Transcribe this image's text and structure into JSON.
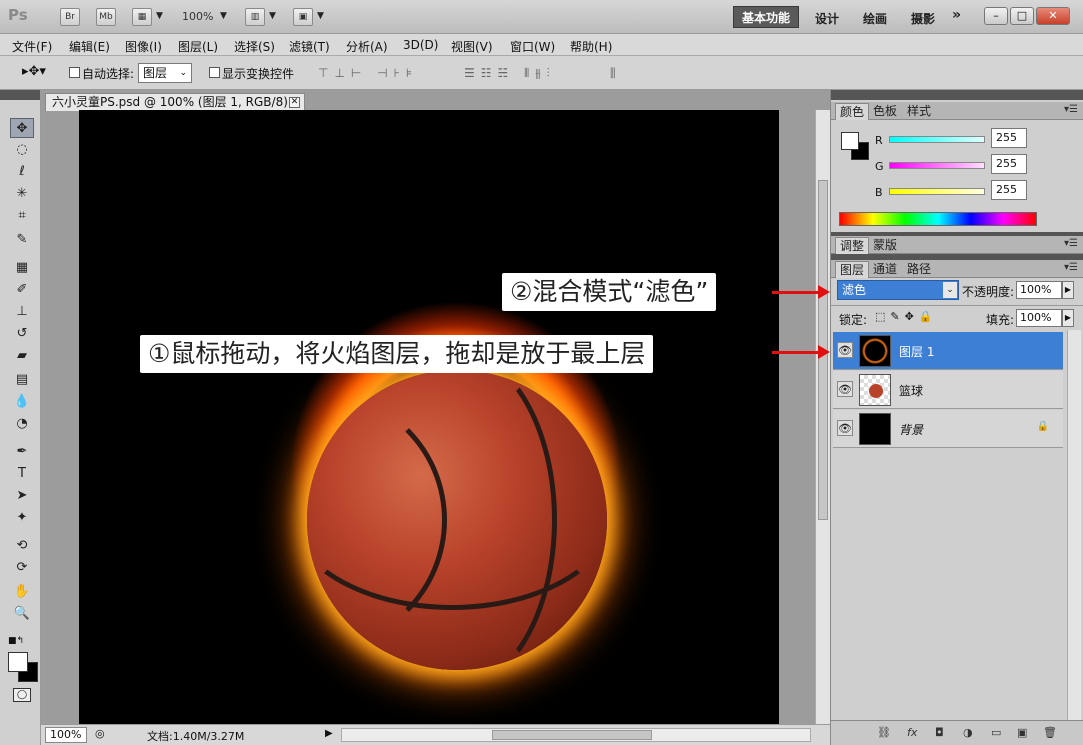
{
  "app": {
    "logo": "Ps",
    "bridge_btn": "Br",
    "minibridge_btn": "Mb",
    "zoom": "100%",
    "workspaces": [
      "基本功能",
      "设计",
      "绘画",
      "摄影"
    ],
    "more": "»"
  },
  "menubar": [
    "文件(F)",
    "编辑(E)",
    "图像(I)",
    "图层(L)",
    "选择(S)",
    "滤镜(T)",
    "分析(A)",
    "3D(D)",
    "视图(V)",
    "窗口(W)",
    "帮助(H)"
  ],
  "options": {
    "auto_select_label": "自动选择:",
    "auto_select_value": "图层",
    "show_transform_label": "显示变换控件"
  },
  "document": {
    "tab_title": "六小灵童PS.psd @ 100% (图层 1, RGB/8) *",
    "zoom": "100%",
    "doc_size": "文档:1.40M/3.27M"
  },
  "color_panel": {
    "tabs": [
      "颜色",
      "色板",
      "样式"
    ],
    "channels": [
      {
        "label": "R",
        "value": "255",
        "color": "#00e0e0"
      },
      {
        "label": "G",
        "value": "255",
        "color": "#e000e0"
      },
      {
        "label": "B",
        "value": "255",
        "color": "#e0e000"
      }
    ]
  },
  "adjust_panel": {
    "tabs": [
      "调整",
      "蒙版"
    ]
  },
  "layers_panel": {
    "tabs": [
      "图层",
      "通道",
      "路径"
    ],
    "blend_mode": "滤色",
    "opacity_label": "不透明度:",
    "opacity": "100%",
    "lock_label": "锁定:",
    "fill_label": "填充:",
    "fill": "100%",
    "layers": [
      {
        "name": "图层 1",
        "selected": true
      },
      {
        "name": "篮球",
        "selected": false
      },
      {
        "name": "背景",
        "selected": false
      }
    ]
  },
  "annotations": {
    "step2": "②混合模式“滤色”",
    "step1": "①鼠标拖动，将火焰图层，拖却是放于最上层"
  },
  "colors": {
    "accent_blue": "#3c7fd4",
    "annotation_arrow": "#e01010"
  }
}
